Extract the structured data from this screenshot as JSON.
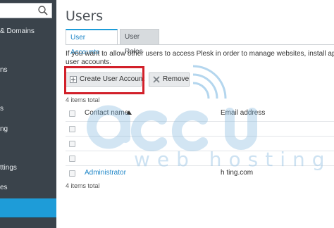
{
  "sidebar": {
    "items": [
      {
        "label": "& Domains"
      },
      {
        "label": "ns"
      },
      {
        "label": "s"
      },
      {
        "label": "ng"
      },
      {
        "label": "ttings"
      },
      {
        "label": "es"
      }
    ]
  },
  "page": {
    "title": "Users"
  },
  "tabs": [
    {
      "label": "User Accounts",
      "active": true
    },
    {
      "label": "User Roles",
      "active": false
    }
  ],
  "description": "If you want to allow other users to access Plesk in order to manage websites, install applicati",
  "description_cont": "user accounts.",
  "toolbar": {
    "create_label": "Create User Account",
    "remove_label": "Remove"
  },
  "items_total_top": "4 items total",
  "items_total_bottom": "4 items total",
  "table": {
    "headers": {
      "name": "Contact name",
      "email": "Email address"
    },
    "rows": [
      {
        "name": "",
        "email": ""
      },
      {
        "name": "",
        "email": ""
      },
      {
        "name": "",
        "email": ""
      },
      {
        "name": "Administrator",
        "email": "h                              ting.com"
      }
    ]
  },
  "watermark": {
    "line1": "accu",
    "line2": "web hosting"
  },
  "colors": {
    "sidebar_bg": "#3a434b",
    "accent": "#1e9cd8",
    "link": "#1e86c8",
    "highlight": "#d2202a"
  }
}
